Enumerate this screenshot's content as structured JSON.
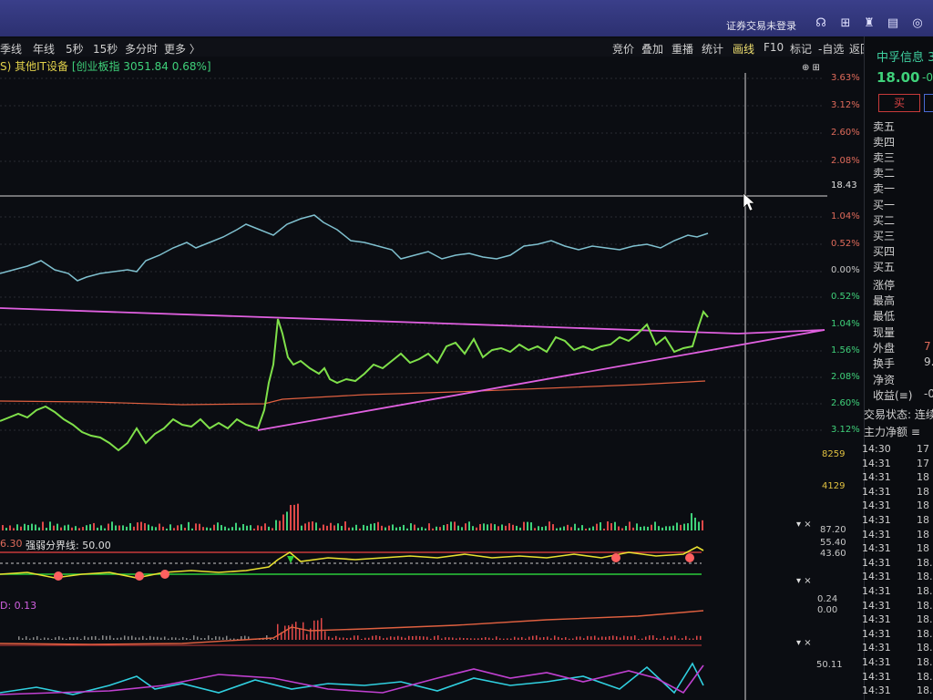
{
  "titlebar": {
    "status": "证券交易未登录",
    "icons": [
      "headset-icon",
      "grid-icon",
      "shirt-icon",
      "document-icon",
      "target-icon"
    ]
  },
  "menu_left": [
    "季线",
    "年线",
    "5秒",
    "15秒",
    "多分时",
    "更多 〉"
  ],
  "menu_right": [
    "竞价",
    "叠加",
    "重播",
    "统计",
    "画线",
    "F10",
    "标记",
    "-自选",
    "返回"
  ],
  "info": {
    "prefix": "S) 其他IT设备",
    "index": "[创业板指 3051.84 0.68%]"
  },
  "price_axis": {
    "top_pcts": [
      "3.63%",
      "3.12%",
      "2.60%",
      "2.08%"
    ],
    "ref_price": "18.43",
    "mid_pcts": [
      "1.04%",
      "0.52%",
      "0.00%"
    ],
    "low_pcts": [
      "0.52%",
      "1.04%",
      "1.56%",
      "2.08%",
      "2.60%",
      "3.12%"
    ]
  },
  "volume_axis": [
    "8259",
    "4129"
  ],
  "indicator1": {
    "label_prefix": "6.30",
    "label": "强弱分界线: 50.00",
    "axis": [
      "87.20",
      "55.40",
      "43.60"
    ]
  },
  "indicator2": {
    "label": "D: 0.13",
    "axis": [
      "0.24",
      "0.00"
    ]
  },
  "indicator3": {
    "axis": [
      "50.11"
    ]
  },
  "quote": {
    "name": "中孚信息",
    "name_tail": "3",
    "price": "18.00",
    "change": "-0.",
    "buy_label": "买",
    "levels": [
      "卖五",
      "卖四",
      "卖三",
      "卖二",
      "卖一",
      "买一",
      "买二",
      "买三",
      "买四",
      "买五"
    ],
    "stats": [
      {
        "label": "涨停",
        "value": ""
      },
      {
        "label": "最高",
        "value": ""
      },
      {
        "label": "最低",
        "value": ""
      },
      {
        "label": "现量",
        "value": ""
      },
      {
        "label": "外盘",
        "value": "7"
      },
      {
        "label": "换手",
        "value": "9."
      },
      {
        "label": "净资",
        "value": ""
      },
      {
        "label": "收益(≡)",
        "value": "-0"
      }
    ],
    "status": "交易状态: 连续",
    "capital": "主力净额 ≡"
  },
  "ticks": [
    {
      "t": "14:30",
      "p": "17"
    },
    {
      "t": "14:31",
      "p": "17"
    },
    {
      "t": "14:31",
      "p": "18"
    },
    {
      "t": "14:31",
      "p": "18"
    },
    {
      "t": "14:31",
      "p": "18"
    },
    {
      "t": "14:31",
      "p": "18"
    },
    {
      "t": "14:31",
      "p": "18"
    },
    {
      "t": "14:31",
      "p": "18"
    },
    {
      "t": "14:31",
      "p": "18.0"
    },
    {
      "t": "14:31",
      "p": "18.0"
    },
    {
      "t": "14:31",
      "p": "18.0"
    },
    {
      "t": "14:31",
      "p": "18.0"
    },
    {
      "t": "14:31",
      "p": "18.0"
    },
    {
      "t": "14:31",
      "p": "18.0"
    },
    {
      "t": "14:31",
      "p": "18.0"
    },
    {
      "t": "14:31",
      "p": "18.0"
    },
    {
      "t": "14:31",
      "p": "18.0"
    },
    {
      "t": "14:31",
      "p": "18.0"
    }
  ]
}
